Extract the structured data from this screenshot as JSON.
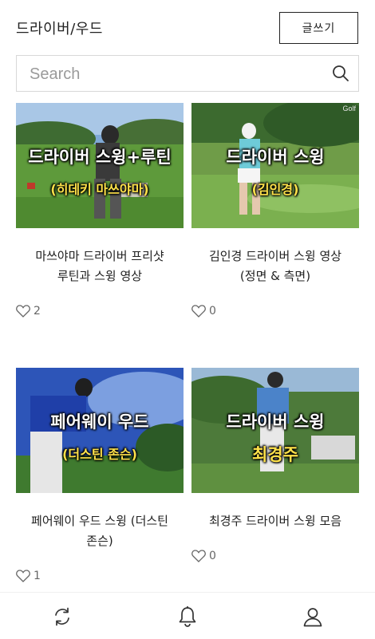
{
  "header": {
    "title": "드라이버/우드",
    "write_label": "글쓰기"
  },
  "search": {
    "placeholder": "Search"
  },
  "posts": [
    {
      "overlay_line1": "드라이버 스윙+루틴",
      "overlay_line2": "(히데키 마쓰야마)",
      "title_line1": "마쓰야마 드라이버 프리샷",
      "title_line2": "루틴과 스윙 영상",
      "likes": "2"
    },
    {
      "overlay_line1": "드라이버 스윙",
      "overlay_line2": "(김인경)",
      "corner_text": "Golf",
      "title_line1": "김인경 드라이버 스윙 영상",
      "title_line2": "(정면 & 측면)",
      "likes": "0"
    },
    {
      "overlay_line1": "페어웨이 우드",
      "overlay_line2": "(더스틴 존슨)",
      "title_line1": "페어웨이 우드 스윙 (더스틴",
      "title_line2": "존슨)",
      "likes": "1"
    },
    {
      "overlay_line1": "드라이버 스윙",
      "overlay_line2": "최경주",
      "title_line1": "최경주 드라이버 스윙 모음",
      "likes": "0"
    }
  ],
  "icons": {
    "search": "search-icon",
    "heart": "heart-icon",
    "refresh": "refresh-icon",
    "bell": "bell-icon",
    "user": "user-icon"
  },
  "colors": {
    "accent": "#222222",
    "overlay_highlight": "#ffe24a"
  }
}
